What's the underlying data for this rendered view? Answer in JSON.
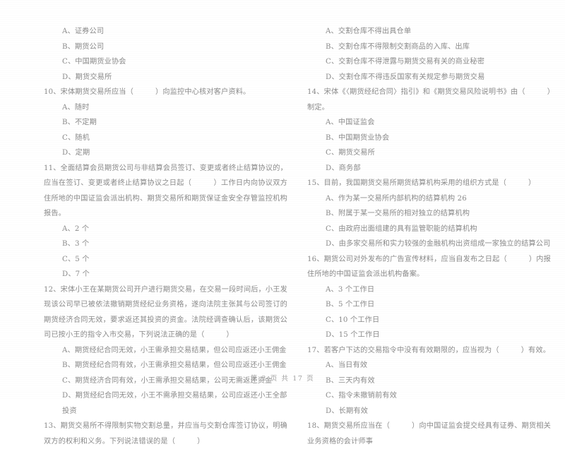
{
  "document": {
    "kind": "scanned-exam-page",
    "language": "zh-CN",
    "text_color": "#8a8a8a",
    "background_color": "#ffffff"
  },
  "footer": {
    "page_label": "第 2 页 共 17 页"
  },
  "left_column": {
    "orphan_options": [
      {
        "id": "q9-opt-a",
        "text": "A、证券公司"
      },
      {
        "id": "q9-opt-b",
        "text": "B、期货公司"
      },
      {
        "id": "q9-opt-c",
        "text": "C、中国期货业协会"
      },
      {
        "id": "q9-opt-d",
        "text": "D、期货交易所"
      }
    ],
    "questions": [
      {
        "number": "10",
        "stem": "10、宋体期货交易所应当（　　　）向监控中心核对客户资料。",
        "options": [
          "A、随时",
          "B、不定期",
          "C、随机",
          "D、定期"
        ]
      },
      {
        "number": "11",
        "stem": "11、全面结算会员期货公司与非结算会员签订、变更或者终止结算协议的，应当在签订、变更或者终止结算协议之日起（　　　）工作日内向协议双方住所地的中国证监会派出机构、期货交易所和期货保证金安全存管监控机构报告。",
        "options": [
          "A、2 个",
          "B、3 个",
          "C、5 个",
          "D、7 个"
        ]
      },
      {
        "number": "12",
        "stem": "12、宋体小王在某期货公司开户进行期货交易，在交易一段时间后，小王发现该公司早已被依法撤销期货经纪业务资格，遂向法院主张其与公司签订的期货经济合同无效，要求返还其投资的资金。法院经调查确认后，该期货公司已按小王的指令入市交易，下列说法正确的是（　　　）",
        "options": [
          "A、期货经纪合同无效，小王需承担交易结果，但公司应返还小王佣金",
          "B、期货经纪合同有效，小王需承担交易结果，但公司应返还小王佣金",
          "C、期货经济合同有效，小王需承担交易结果，公司无需返还资金",
          "D、期货经纪合同无效，小王不需承担交易结果，公司应返还小王全部投资"
        ]
      },
      {
        "number": "13",
        "stem": "13、期货交易所不得限制实物交割总量，并应当与交割仓库签订协议，明确双方的权利和义务。下列说法错误的是（　　　）",
        "options": []
      }
    ]
  },
  "right_column": {
    "orphan_options": [
      {
        "id": "q13-opt-a",
        "text": "A、交割仓库不得出具仓单"
      },
      {
        "id": "q13-opt-b",
        "text": "B、交割仓库不得限制交割商品的入库、出库"
      },
      {
        "id": "q13-opt-c",
        "text": "C、交割仓库不得泄露与期货交易有关的商业秘密"
      },
      {
        "id": "q13-opt-d",
        "text": "D、交割仓库不得违反国家有关规定参与期货交易"
      }
    ],
    "questions": [
      {
        "number": "14",
        "stem": "14、宋体《〈期货经纪合同〉指引》和《期货交易风险说明书》由（　　　）制定。",
        "options": [
          "A、中国证监会",
          "B、中国期货业协会",
          "C、期货交易所",
          "D、商务部"
        ]
      },
      {
        "number": "15",
        "stem": "15、目前，我国期货交易所期货结算机构采用的组织方式是（　　　）",
        "options": [
          "A、作为某一交易所内部机构的结算机构 26",
          "B、附属于某一交易所的相对独立的结算机构",
          "C、由政府出面组建的具有监管职能的结算机构",
          "D、由多家交易所和实力较强的金融机构出资组成一家独立的结算公司"
        ]
      },
      {
        "number": "16",
        "stem": "16、期货公司对外发布的广告宣传材料，应当自发布之日起（　　　）内报住所地的中国证监会派出机构备案。",
        "options": [
          "A、3 个工作日",
          "B、5 个工作日",
          "C、10 个工作日",
          "D、15 个工作日"
        ]
      },
      {
        "number": "17",
        "stem": "17、若客户下达的交易指令中没有有效期限的，应当视为（　　　）有效。",
        "options": [
          "A、当日有效",
          "B、三天内有效",
          "C、指令未撤销前有效",
          "D、长期有效"
        ]
      },
      {
        "number": "18",
        "stem": "18、期货交易所应当在（　　　）向中国证监会提交经具有证券、期货相关业务资格的会计师事",
        "options": []
      }
    ]
  }
}
